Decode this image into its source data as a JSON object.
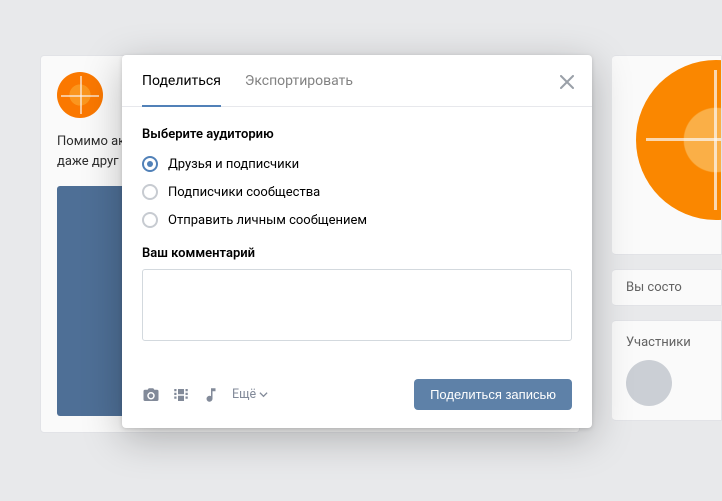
{
  "post": {
    "text": "Помимо актуальной прослушивания персональной собственной человек име и даже друг"
  },
  "sidebar": {
    "status": "Вы состо",
    "members_title": "Участники"
  },
  "modal": {
    "tabs": {
      "share": "Поделиться",
      "export": "Экспортировать"
    },
    "audience_title": "Выберите аудиторию",
    "options": {
      "friends": "Друзья и подписчики",
      "community": "Подписчики сообщества",
      "private": "Отправить личным сообщением"
    },
    "comment_label": "Ваш комментарий",
    "more": "Ещё",
    "submit": "Поделиться записью"
  }
}
